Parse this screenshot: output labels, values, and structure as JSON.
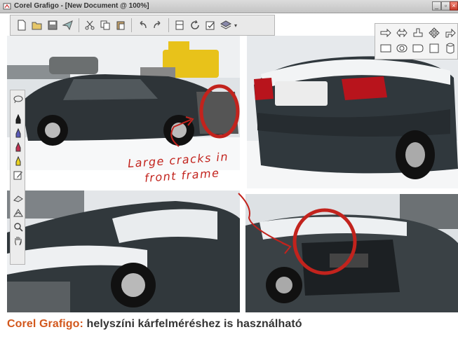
{
  "window": {
    "title": "Corel Grafigo - [New Document @ 100%]"
  },
  "toolbar": {
    "buttons": [
      "new-document",
      "open",
      "save",
      "send",
      "cut",
      "copy",
      "paste",
      "undo",
      "redo",
      "frame",
      "refresh",
      "properties",
      "layers"
    ]
  },
  "annotation": {
    "line1": "Large cracks in",
    "line2": "front frame",
    "color": "#c2231d"
  },
  "caption": {
    "brand": "Corel Grafigo:",
    "text": "helyszíni kárfelméréshez is használható",
    "brand_color": "#d2571c"
  },
  "colors": {
    "annotation_red": "#c2231d",
    "caption_brand": "#d2571c"
  }
}
